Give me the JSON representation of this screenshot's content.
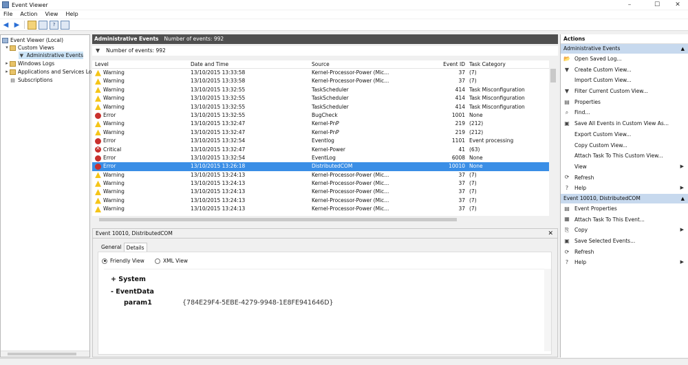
{
  "window": {
    "title": "Event Viewer",
    "min": "–",
    "max": "☐",
    "close": "✕",
    "resize_grip": "✕"
  },
  "menu": [
    "File",
    "Action",
    "View",
    "Help"
  ],
  "toolbar": {
    "back": "◀",
    "forward": "▶",
    "help": "?"
  },
  "tree": {
    "root": "Event Viewer (Local)",
    "custom_views": "Custom Views",
    "admin_events": "Administrative Events",
    "windows_logs": "Windows Logs",
    "apps_services": "Applications and Services Lo",
    "subscriptions": "Subscriptions"
  },
  "center": {
    "header_title": "Administrative Events",
    "header_count": "Number of events: 992",
    "filter_text": "Number of events: 992",
    "columns": {
      "level": "Level",
      "date": "Date and Time",
      "source": "Source",
      "id": "Event ID",
      "category": "Task Category"
    },
    "rows": [
      {
        "level": "Warning",
        "type": "warn",
        "date": "13/10/2015 13:33:58",
        "source": "Kernel-Processor-Power (Mic...",
        "id": "37",
        "category": "(7)"
      },
      {
        "level": "Warning",
        "type": "warn",
        "date": "13/10/2015 13:33:58",
        "source": "Kernel-Processor-Power (Mic...",
        "id": "37",
        "category": "(7)"
      },
      {
        "level": "Warning",
        "type": "warn",
        "date": "13/10/2015 13:32:55",
        "source": "TaskScheduler",
        "id": "414",
        "category": "Task Misconfiguration"
      },
      {
        "level": "Warning",
        "type": "warn",
        "date": "13/10/2015 13:32:55",
        "source": "TaskScheduler",
        "id": "414",
        "category": "Task Misconfiguration"
      },
      {
        "level": "Warning",
        "type": "warn",
        "date": "13/10/2015 13:32:55",
        "source": "TaskScheduler",
        "id": "414",
        "category": "Task Misconfiguration"
      },
      {
        "level": "Error",
        "type": "err",
        "date": "13/10/2015 13:32:55",
        "source": "BugCheck",
        "id": "1001",
        "category": "None"
      },
      {
        "level": "Warning",
        "type": "warn",
        "date": "13/10/2015 13:32:47",
        "source": "Kernel-PnP",
        "id": "219",
        "category": "(212)"
      },
      {
        "level": "Warning",
        "type": "warn",
        "date": "13/10/2015 13:32:47",
        "source": "Kernel-PnP",
        "id": "219",
        "category": "(212)"
      },
      {
        "level": "Error",
        "type": "err",
        "date": "13/10/2015 13:32:54",
        "source": "Eventlog",
        "id": "1101",
        "category": "Event processing"
      },
      {
        "level": "Critical",
        "type": "crit",
        "date": "13/10/2015 13:32:47",
        "source": "Kernel-Power",
        "id": "41",
        "category": "(63)"
      },
      {
        "level": "Error",
        "type": "err",
        "date": "13/10/2015 13:32:54",
        "source": "EventLog",
        "id": "6008",
        "category": "None"
      },
      {
        "level": "Error",
        "type": "err",
        "date": "13/10/2015 13:26:18",
        "source": "DistributedCOM",
        "id": "10010",
        "category": "None",
        "selected": true
      },
      {
        "level": "Warning",
        "type": "warn",
        "date": "13/10/2015 13:24:13",
        "source": "Kernel-Processor-Power (Mic...",
        "id": "37",
        "category": "(7)"
      },
      {
        "level": "Warning",
        "type": "warn",
        "date": "13/10/2015 13:24:13",
        "source": "Kernel-Processor-Power (Mic...",
        "id": "37",
        "category": "(7)"
      },
      {
        "level": "Warning",
        "type": "warn",
        "date": "13/10/2015 13:24:13",
        "source": "Kernel-Processor-Power (Mic...",
        "id": "37",
        "category": "(7)"
      },
      {
        "level": "Warning",
        "type": "warn",
        "date": "13/10/2015 13:24:13",
        "source": "Kernel-Processor-Power (Mic...",
        "id": "37",
        "category": "(7)"
      },
      {
        "level": "Warning",
        "type": "warn",
        "date": "13/10/2015 13:24:13",
        "source": "Kernel-Processor-Power (Mic...",
        "id": "37",
        "category": "(7)"
      }
    ]
  },
  "detail": {
    "title": "Event 10010, DistributedCOM",
    "close": "✕",
    "tabs": [
      "General",
      "Details"
    ],
    "friendly": "Friendly View",
    "xml": "XML View",
    "system": "+  System",
    "eventdata": "-  EventData",
    "param_name": "param1",
    "param_value": "{784E29F4-5EBE-4279-9948-1E8FE941646D}"
  },
  "actions": {
    "title": "Actions",
    "section1": "Administrative Events",
    "items1": [
      {
        "label": "Open Saved Log...",
        "icon": "open-log-icon",
        "glyph": "📂"
      },
      {
        "label": "Create Custom View...",
        "icon": "filter-icon",
        "glyph": "▼"
      },
      {
        "label": "Import Custom View...",
        "icon": "import-icon",
        "glyph": ""
      },
      {
        "label": "Filter Current Custom View...",
        "icon": "filter-icon",
        "glyph": "▼"
      },
      {
        "label": "Properties",
        "icon": "properties-icon",
        "glyph": "▤"
      },
      {
        "label": "Find...",
        "icon": "find-icon",
        "glyph": "⌕"
      },
      {
        "label": "Save All Events in Custom View As...",
        "icon": "save-icon",
        "glyph": "▣"
      },
      {
        "label": "Export Custom View...",
        "icon": "export-icon",
        "glyph": ""
      },
      {
        "label": "Copy Custom View...",
        "icon": "copy-icon",
        "glyph": ""
      },
      {
        "label": "Attach Task To This Custom View...",
        "icon": "attach-task-icon",
        "glyph": ""
      },
      {
        "label": "View",
        "icon": "view-icon",
        "glyph": "",
        "sub": true
      },
      {
        "label": "Refresh",
        "icon": "refresh-icon",
        "glyph": "⟳"
      },
      {
        "label": "Help",
        "icon": "help-icon",
        "glyph": "?",
        "sub": true
      }
    ],
    "section2": "Event 10010, DistributedCOM",
    "items2": [
      {
        "label": "Event Properties",
        "icon": "event-properties-icon",
        "glyph": "▤"
      },
      {
        "label": "Attach Task To This Event...",
        "icon": "attach-task-icon",
        "glyph": "▦"
      },
      {
        "label": "Copy",
        "icon": "copy-icon",
        "glyph": "⎘",
        "sub": true
      },
      {
        "label": "Save Selected Events...",
        "icon": "save-icon",
        "glyph": "▣"
      },
      {
        "label": "Refresh",
        "icon": "refresh-icon",
        "glyph": "⟳"
      },
      {
        "label": "Help",
        "icon": "help-icon",
        "glyph": "?",
        "sub": true
      }
    ]
  }
}
